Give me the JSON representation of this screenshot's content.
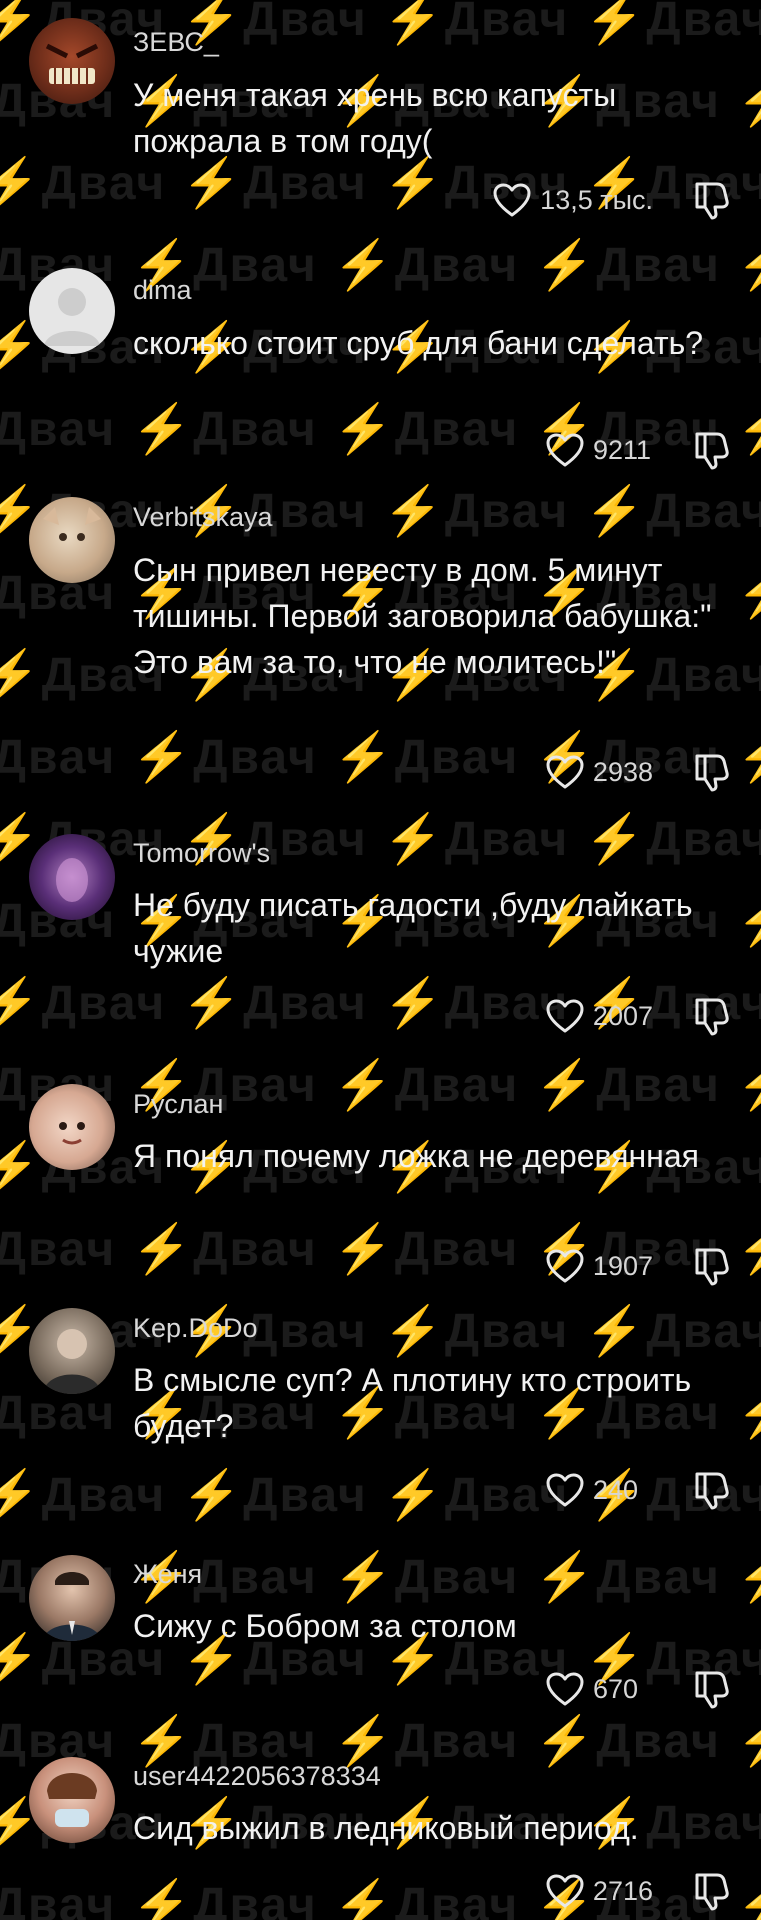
{
  "watermark": {
    "text": "⚡Двач"
  },
  "comments": [
    {
      "username": "ЗЕВС_",
      "text": "У меня такая хрень всю капусты пожрала в том году(",
      "likes": "13,5 тыс."
    },
    {
      "username": "dima",
      "text": "сколько стоит сруб для бани сделать?",
      "likes": "9211"
    },
    {
      "username": "Verbitskaya",
      "text": "Сын привел невесту в дом. 5 минут тишины. Первой заговорила бабушка:\" Это вам за то, что не молитесь!\"",
      "likes": "2938"
    },
    {
      "username": "Tomorrow's",
      "text": "Не буду писать гадости ,буду лайкать чужие",
      "likes": "2007"
    },
    {
      "username": "Руслан",
      "text": "Я понял почему ложка не деревянная",
      "likes": "1907"
    },
    {
      "username": "Kep.DoDo",
      "text": "В смысле суп? А плотину кто строить будет?",
      "likes": "240"
    },
    {
      "username": "Женя",
      "text": "Сижу с Бобром за столом",
      "likes": "670"
    },
    {
      "username": "user4422056378334",
      "text": "Сид выжил в ледниковый период.",
      "likes": "2716"
    }
  ],
  "icons": {
    "like": "heart-outline-icon",
    "dislike": "thumbs-down-outline-icon"
  }
}
